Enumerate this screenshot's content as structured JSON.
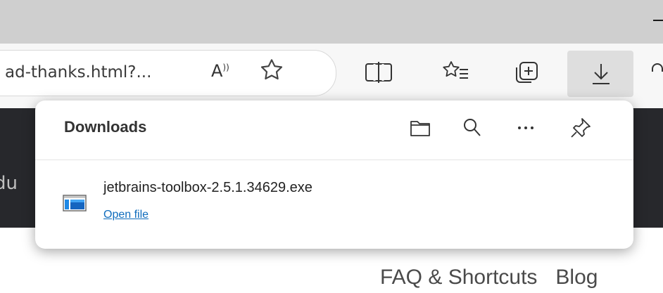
{
  "browser": {
    "address_url": "ad-thanks.html?...",
    "read_aloud_label": "A",
    "icons": {
      "read_aloud": "read-aloud-icon",
      "favorite": "star-icon",
      "split_screen": "split-screen-icon",
      "favorites": "favorites-list-icon",
      "collections": "collections-icon",
      "downloads": "download-arrow-icon",
      "profile": "profile-icon"
    }
  },
  "downloads_panel": {
    "title": "Downloads",
    "action_icons": [
      "folder-icon",
      "search-icon",
      "more-icon",
      "pin-icon"
    ],
    "items": [
      {
        "file_name": "jetbrains-toolbox-2.5.1.34629.exe",
        "action": "Open file"
      }
    ]
  },
  "page": {
    "dark_band_text": "du",
    "nav": [
      "FAQ & Shortcuts",
      "Blog"
    ]
  },
  "colors": {
    "link": "#0f6cbd",
    "titlebar": "#cfcfcf",
    "dark_band": "#27282c"
  }
}
